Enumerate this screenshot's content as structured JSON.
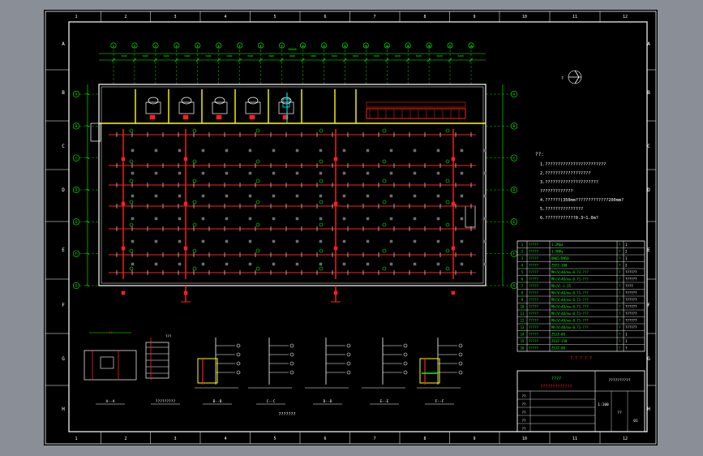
{
  "drawing": {
    "colors": {
      "background": "#000000",
      "frame": "#ffffff",
      "dimension": "#00ff00",
      "pipe": "#ff2020",
      "wall": "#ffff00",
      "water": "#00ffff",
      "fixture": "#ff00ff"
    },
    "border_columns": [
      "1",
      "2",
      "3",
      "4",
      "5",
      "6",
      "7",
      "8",
      "9",
      "10",
      "11",
      "12"
    ],
    "border_rows": [
      "A",
      "B",
      "C",
      "D",
      "E",
      "F",
      "G",
      "H"
    ],
    "axis_numbers": [
      "1",
      "2",
      "3",
      "4",
      "5",
      "6",
      "7",
      "8",
      "9",
      "10",
      "11",
      "12",
      "13",
      "14",
      "15",
      "16",
      "17",
      "18"
    ],
    "axis_letters": [
      "A",
      "B",
      "C",
      "D",
      "E",
      "F",
      "G"
    ],
    "overall_dim": "36000",
    "notes_heading": "??:",
    "notes": [
      "1.????????????????????????",
      "2.??????????????????",
      "3.?????????????????????",
      "   ?????????????",
      "4.??????(350mm?????????????200mm?",
      "5.???????????????",
      "6.????????????0.3~1.0m?"
    ],
    "north_label": "?",
    "legend_rows": [
      [
        "1",
        "?????",
        "1.2Mpa",
        "?",
        "1"
      ],
      [
        "2",
        "?????",
        "1.5MPa",
        "?",
        "2"
      ],
      [
        "3",
        "?????",
        "DN65/DN50",
        "?",
        "1"
      ],
      [
        "4",
        "?????",
        "ZSFZ-100",
        "?",
        "2"
      ],
      [
        "5",
        "?????",
        "Mh(V)40/mu-0.71-???",
        "?",
        "??????"
      ],
      [
        "6",
        "?????",
        "Mh(V)40/mu-0.71-???",
        "?",
        "??????"
      ],
      [
        "7",
        "?????",
        "Mh(V)-L-25",
        "?",
        "????"
      ],
      [
        "8",
        "?????",
        "Mh(V)40/mu-0.71-???",
        "?",
        "??????"
      ],
      [
        "9",
        "?????",
        "Mh(V)40/mu-0.71-???",
        "?",
        "??????"
      ],
      [
        "10",
        "?????",
        "Mh(V)40/mu-0.71-???",
        "?",
        "??????"
      ],
      [
        "11",
        "?????",
        "Mh(V)40/mu-0.71-???",
        "?",
        "??????"
      ],
      [
        "12",
        "?????",
        "Mh(V)40/mu-0.71-???",
        "?",
        "??????"
      ],
      [
        "13",
        "?????",
        "Mh(V)40/mu-0.71-???",
        "?",
        "??????"
      ],
      [
        "14",
        "?????",
        "ZSJZ-80",
        "?",
        "1"
      ],
      [
        "15",
        "?????",
        "ZSJZ-150",
        "?",
        "1"
      ],
      [
        "16",
        "?????",
        "ZSJZ-80",
        "?",
        "?"
      ]
    ],
    "legend_caption": "? ? ? ? ?",
    "title_block": {
      "project": "????",
      "drawing_title": "?????????????",
      "school": "??????????",
      "row_1": "??",
      "row_2": "??",
      "row_3": "??",
      "row_4": "??",
      "row_5": "??",
      "scale": "1:100",
      "sheet": "??",
      "number": "01"
    },
    "sections": [
      {
        "label": "A--A"
      },
      {
        "label": "?????????"
      },
      {
        "label": "B--B"
      },
      {
        "label": "C--C"
      },
      {
        "label": "D--D"
      },
      {
        "label": "E--E"
      },
      {
        "label": "F--F"
      }
    ],
    "section_heading": "???????",
    "section_tag_a": "??",
    "section_tag_b": "???"
  }
}
